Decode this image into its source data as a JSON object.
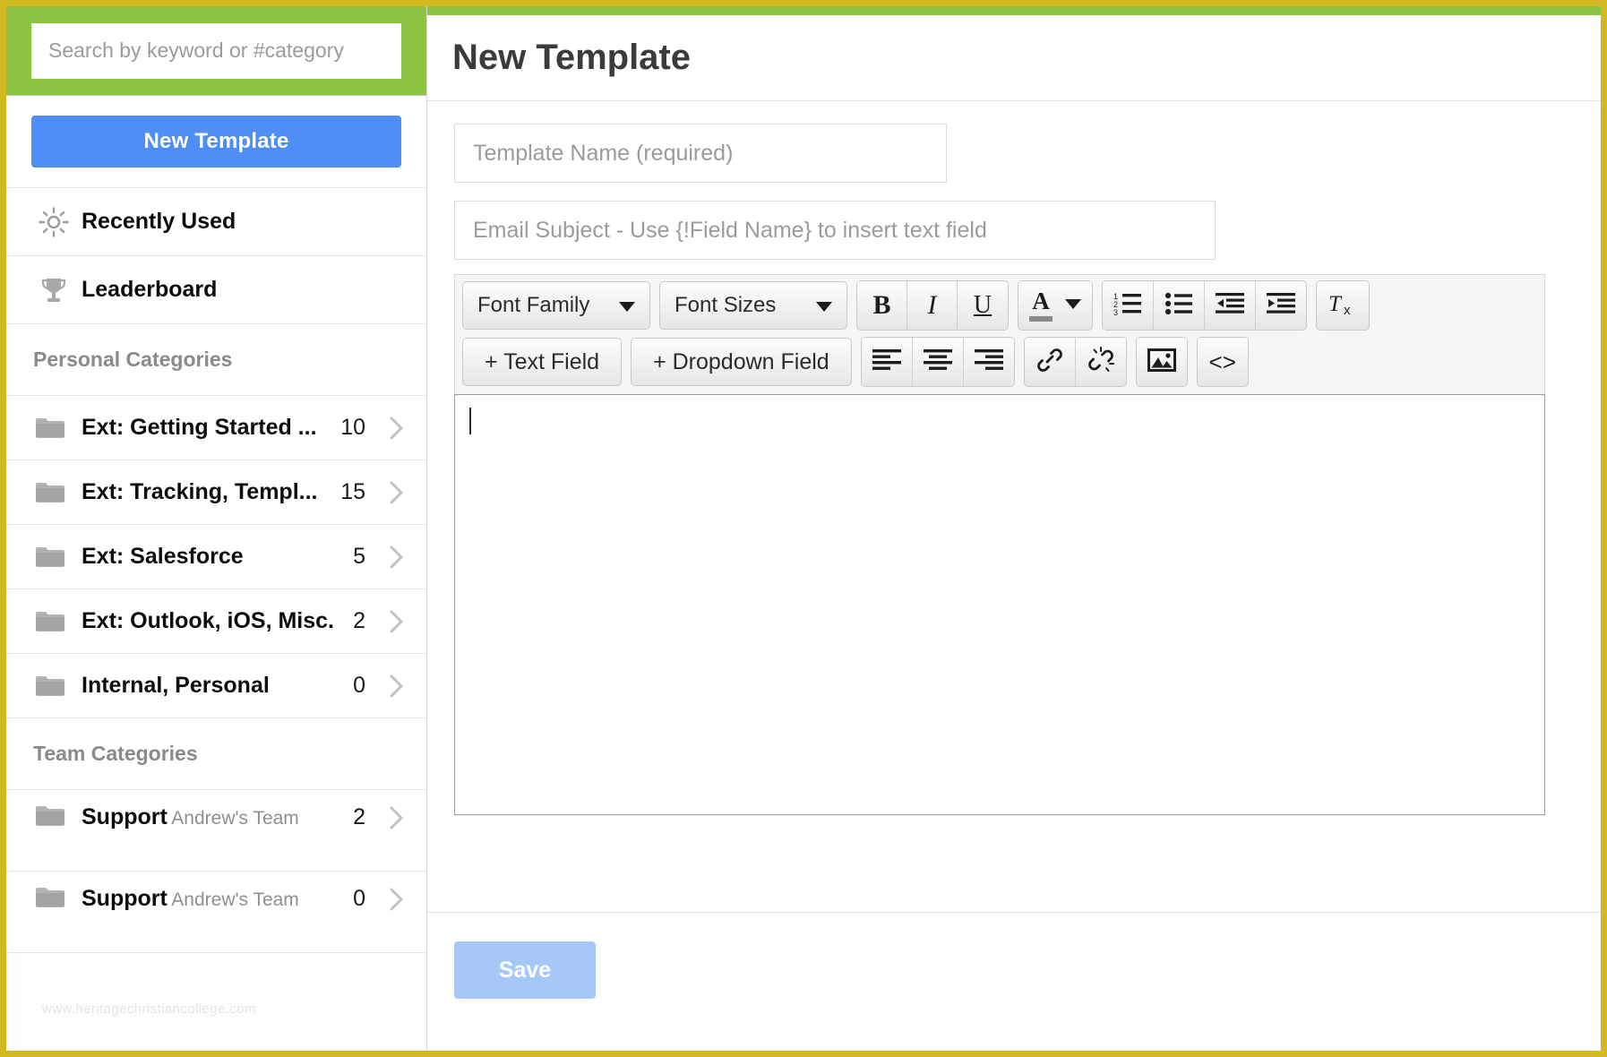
{
  "sidebar": {
    "search": {
      "placeholder": "Search by keyword or #category",
      "value": ""
    },
    "new_template_label": "New Template",
    "nav": [
      {
        "label": "Recently Used",
        "icon": "sun-icon"
      },
      {
        "label": "Leaderboard",
        "icon": "trophy-icon"
      }
    ],
    "personal_section_label": "Personal Categories",
    "personal_categories": [
      {
        "name": "Ext: Getting Started ...",
        "count": "10"
      },
      {
        "name": "Ext: Tracking, Templ...",
        "count": "15"
      },
      {
        "name": "Ext: Salesforce",
        "count": "5"
      },
      {
        "name": "Ext: Outlook, iOS, Misc.",
        "count": "2"
      },
      {
        "name": "Internal, Personal",
        "count": "0"
      }
    ],
    "team_section_label": "Team Categories",
    "team_categories": [
      {
        "name": "Support",
        "sub": "Andrew's Team",
        "count": "2"
      },
      {
        "name": "Support",
        "sub": "Andrew's Team",
        "count": "0"
      }
    ],
    "watermark": "www.heritagechristiancollege.com"
  },
  "main": {
    "title": "New Template",
    "template_name": {
      "placeholder": "Template Name (required)",
      "value": ""
    },
    "email_subject": {
      "placeholder": "Email Subject - Use {!Field Name} to insert text field",
      "value": ""
    },
    "toolbar": {
      "font_family_label": "Font Family",
      "font_sizes_label": "Font Sizes",
      "bold_label": "B",
      "italic_label": "I",
      "underline_label": "U",
      "text_color_label": "A",
      "ordered_list_label": "ordered-list",
      "unordered_list_label": "unordered-list",
      "outdent_label": "outdent",
      "indent_label": "indent",
      "clear_format_label": "clear-formatting",
      "text_field_label": "+ Text Field",
      "dropdown_field_label": "+ Dropdown Field",
      "align_left_label": "align-left",
      "align_center_label": "align-center",
      "align_right_label": "align-right",
      "link_label": "link",
      "unlink_label": "unlink",
      "image_label": "image",
      "source_code_label": "<>"
    },
    "editor": {
      "content": ""
    },
    "save_label": "Save"
  },
  "colors": {
    "frame": "#d4b81f",
    "green": "#8cc341",
    "primary_blue": "#4f8ef7",
    "save_blue": "#a5c8f7"
  }
}
